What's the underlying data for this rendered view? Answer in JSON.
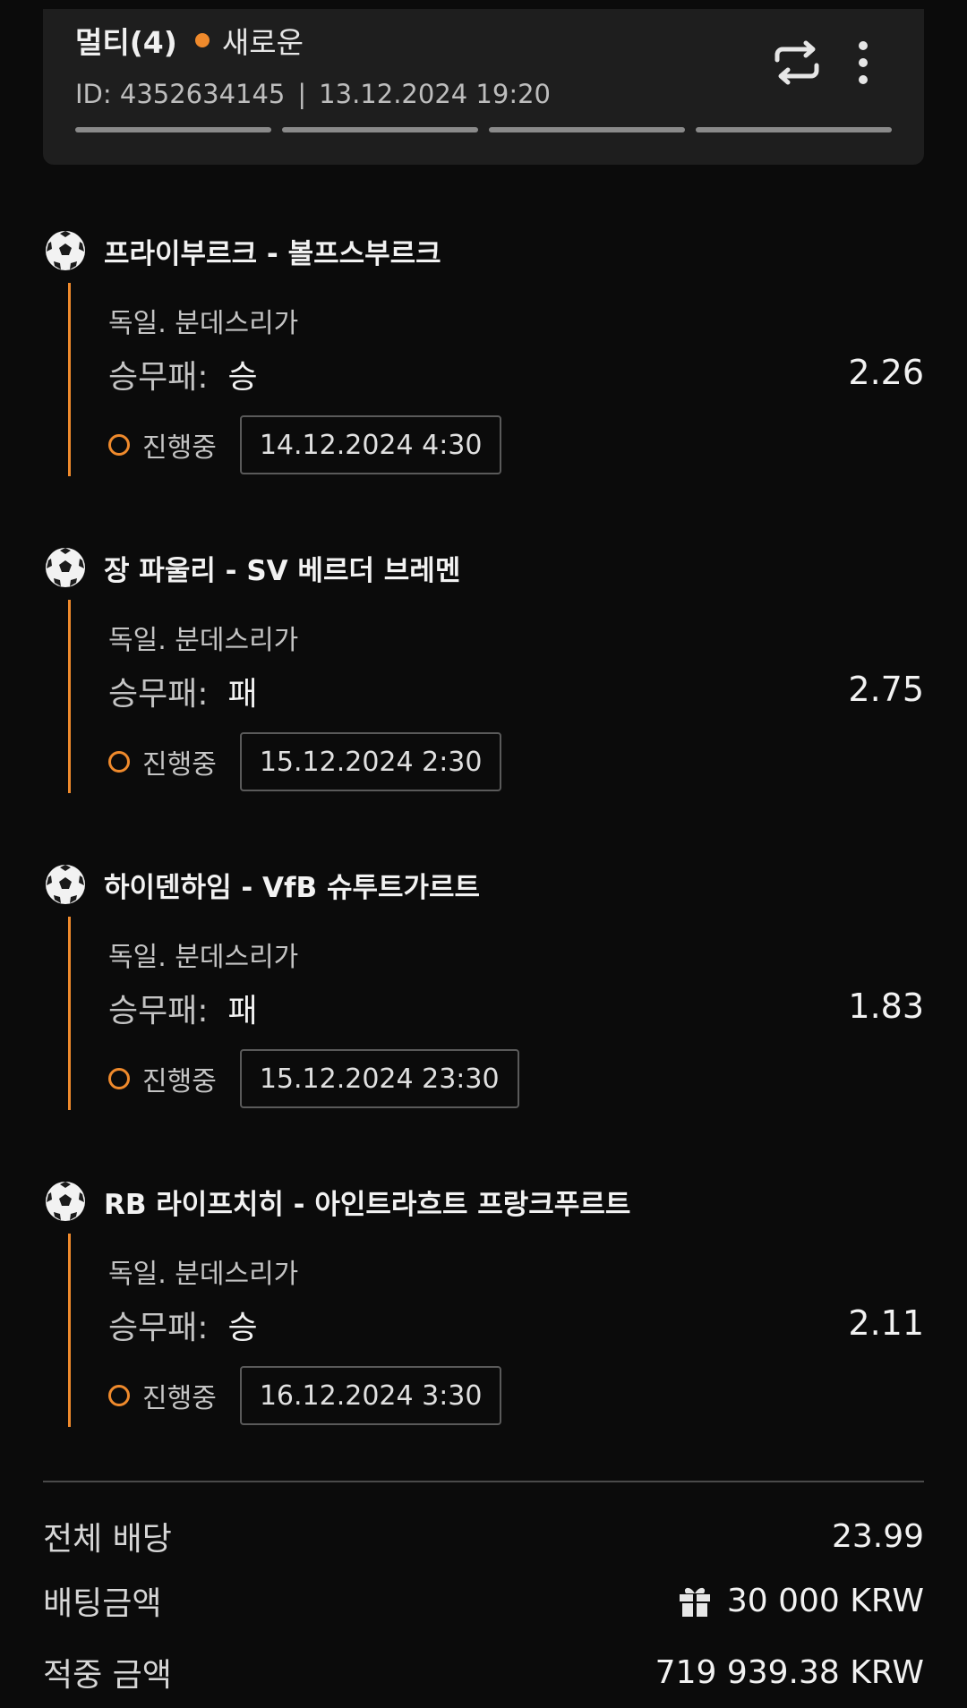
{
  "header": {
    "title": "멀티(4)",
    "status": "새로운",
    "id_text": "ID: 4352634145",
    "separator": "|",
    "datetime": "13.12.2024 19:20",
    "progress_segments": 4
  },
  "selections": [
    {
      "match": "프라이부르크 - 볼프스부르크",
      "league": "독일. 분데스리가",
      "market": "승무패:",
      "pick": "승",
      "odds": "2.26",
      "status": "진행중",
      "date": "14.12.2024 4:30"
    },
    {
      "match": "장 파울리 - SV 베르더 브레멘",
      "league": "독일. 분데스리가",
      "market": "승무패:",
      "pick": "패",
      "odds": "2.75",
      "status": "진행중",
      "date": "15.12.2024 2:30"
    },
    {
      "match": "하이덴하임 - VfB 슈투트가르트",
      "league": "독일. 분데스리가",
      "market": "승무패:",
      "pick": "패",
      "odds": "1.83",
      "status": "진행중",
      "date": "15.12.2024 23:30"
    },
    {
      "match": "RB 라이프치히 - 아인트라흐트 프랑크푸르트",
      "league": "독일. 분데스리가",
      "market": "승무패:",
      "pick": "승",
      "odds": "2.11",
      "status": "진행중",
      "date": "16.12.2024 3:30"
    }
  ],
  "summary": {
    "total_odds_label": "전체 배당",
    "total_odds_value": "23.99",
    "stake_label": "배팅금액",
    "stake_value": "30 000 KRW",
    "win_label": "적중 금액",
    "win_value": "719 939.38 KRW"
  },
  "colors": {
    "accent": "#ef8a2c",
    "background": "#0b0b0b",
    "card": "#1e1e1e"
  },
  "icons": {
    "repeat": "repeat-icon",
    "more": "more-vertical-icon",
    "sport": "soccer-ball-icon",
    "pending": "pending-circle-icon",
    "gift": "gift-icon"
  }
}
